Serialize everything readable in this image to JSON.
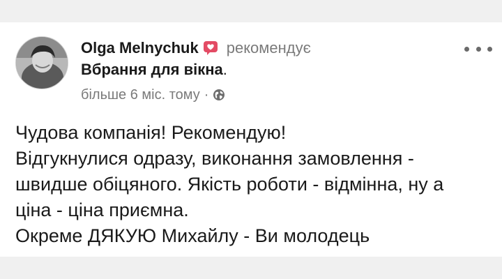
{
  "post": {
    "author": "Olga Melnychuk",
    "action": "рекомендує",
    "page_name": "Вбрання для вікна",
    "period": ".",
    "timestamp": "більше 6 міс. тому",
    "separator": "·",
    "badge_icon": "recommend-heart-icon",
    "privacy_icon": "globe-icon",
    "more_icon": "more-options-icon",
    "badge_color": "#e34b64",
    "body_lines": [
      "Чудова компанія! Рекомендую!",
      "Відгукнулися одразу, виконання замовлення -",
      "швидше обіцяного. Якість роботи - відмінна, ну а",
      "ціна - ціна приємна.",
      "Окреме ДЯКУЮ Михайлу - Ви молодець"
    ]
  }
}
